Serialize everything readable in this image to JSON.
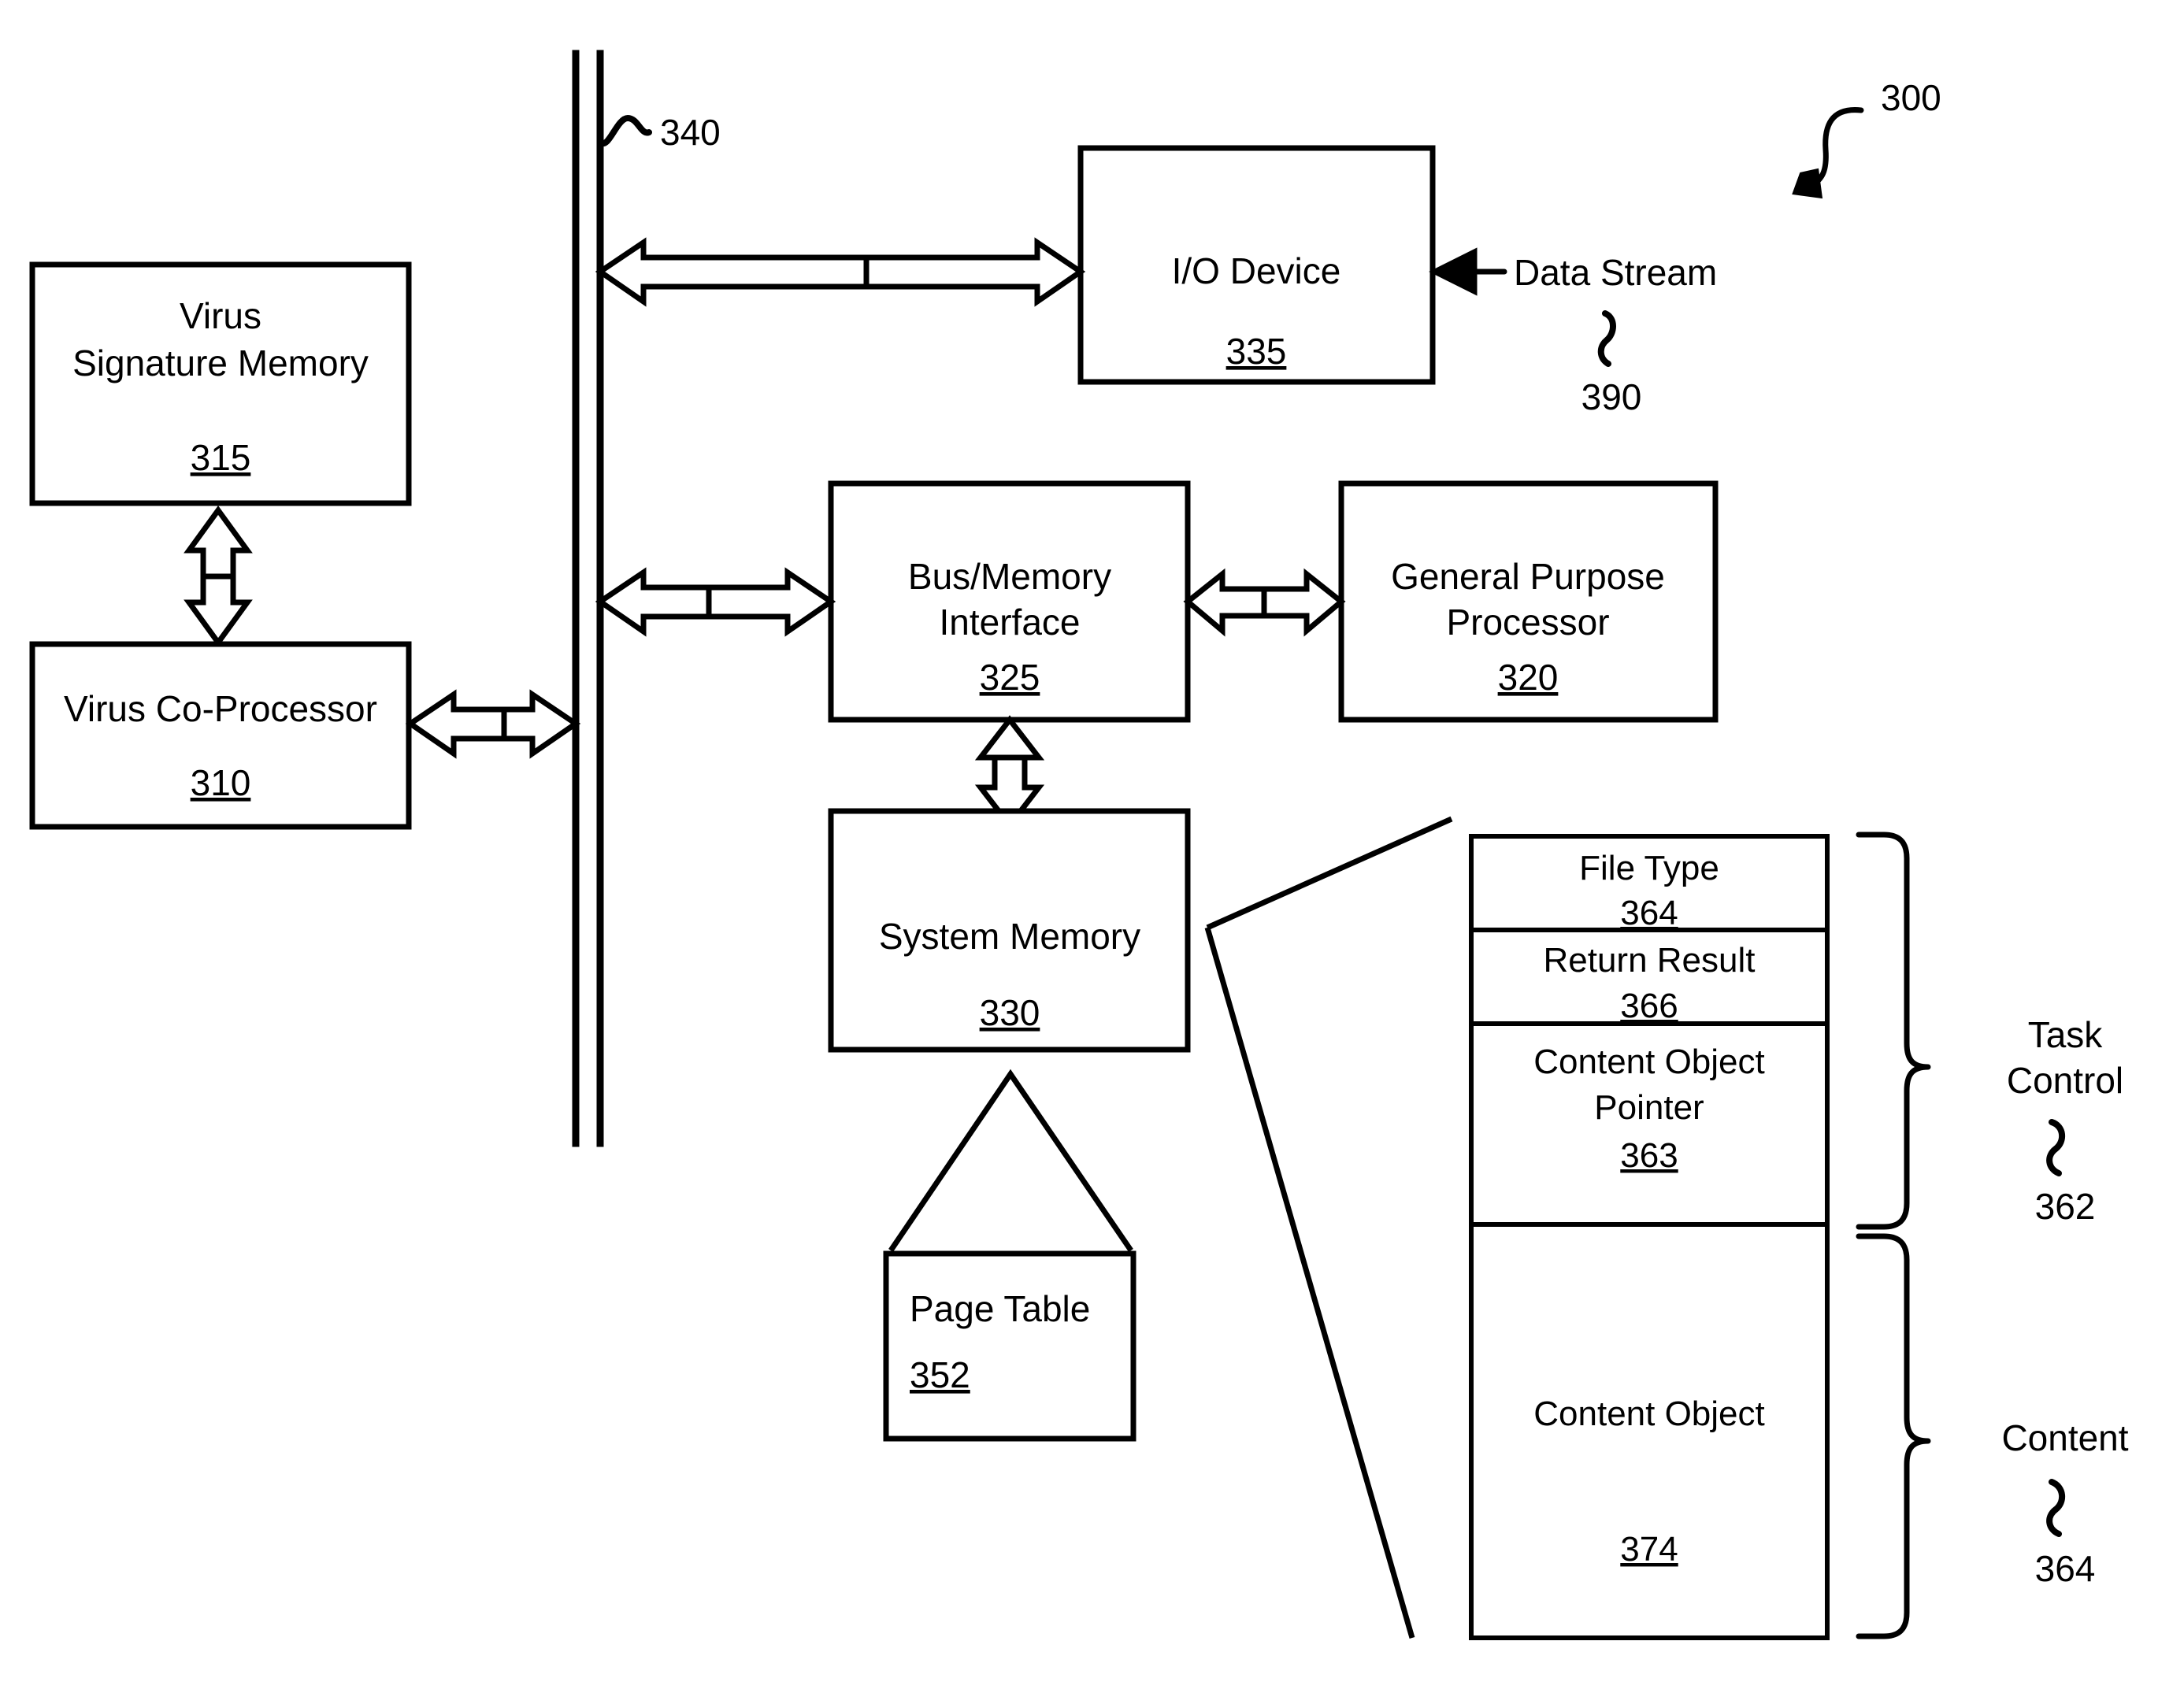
{
  "figure": {
    "figure_number": "300",
    "bus_label": "340",
    "data_stream": {
      "label": "Data Stream",
      "ref": "390"
    }
  },
  "blocks": {
    "virus_signature_memory": {
      "line1": "Virus",
      "line2": "Signature Memory",
      "ref": "315"
    },
    "virus_coprocessor": {
      "line1": "Virus Co-Processor",
      "ref": "310"
    },
    "io_device": {
      "line1": "I/O Device",
      "ref": "335"
    },
    "bus_memory_interface": {
      "line1": "Bus/Memory",
      "line2": "Interface",
      "ref": "325"
    },
    "general_purpose_processor": {
      "line1": "General Purpose",
      "line2": "Processor",
      "ref": "320"
    },
    "system_memory": {
      "line1": "System Memory",
      "ref": "330"
    },
    "page_table": {
      "line1": "Page Table",
      "ref": "352"
    }
  },
  "task_structure": {
    "cells": [
      {
        "name": "file-type",
        "label_line1": "File Type",
        "label_line2": "",
        "ref": "364"
      },
      {
        "name": "return-result",
        "label_line1": "Return Result",
        "label_line2": "",
        "ref": "366"
      },
      {
        "name": "content-object-pointer",
        "label_line1": "Content Object",
        "label_line2": "Pointer",
        "ref": "363"
      },
      {
        "name": "content-object",
        "label_line1": "Content Object",
        "label_line2": "",
        "ref": "374"
      }
    ],
    "braces": [
      {
        "name": "task-control",
        "line1": "Task",
        "line2": "Control",
        "ref": "362"
      },
      {
        "name": "content",
        "line1": "Content",
        "line2": "",
        "ref": "364"
      }
    ]
  }
}
